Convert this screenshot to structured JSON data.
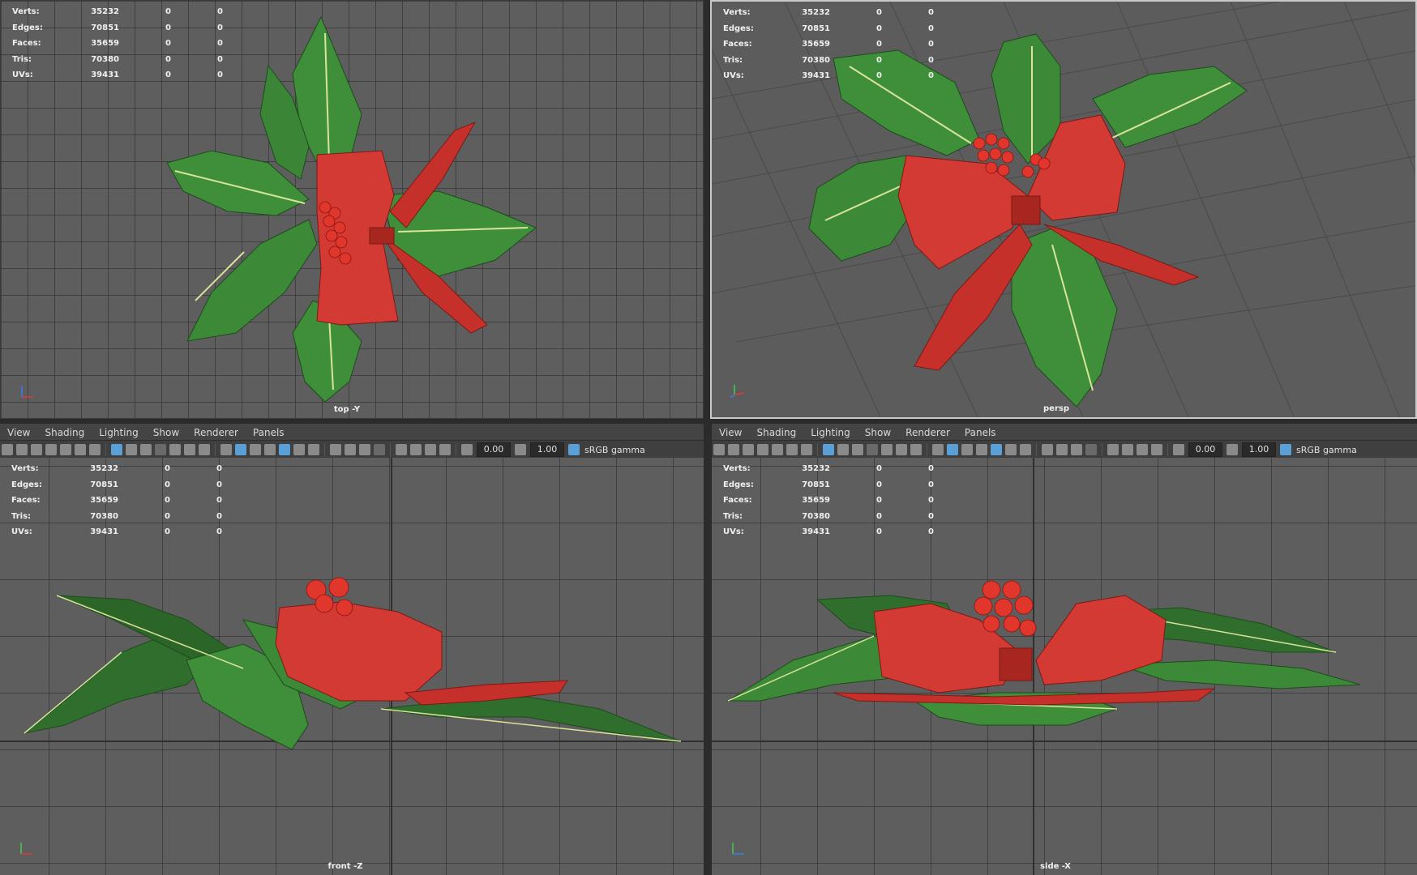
{
  "hud": {
    "rows": [
      {
        "label": "Verts:",
        "value": "35232",
        "c1": "0",
        "c2": "0"
      },
      {
        "label": "Edges:",
        "value": "70851",
        "c1": "0",
        "c2": "0"
      },
      {
        "label": "Faces:",
        "value": "35659",
        "c1": "0",
        "c2": "0"
      },
      {
        "label": "Tris:",
        "value": "70380",
        "c1": "0",
        "c2": "0"
      },
      {
        "label": "UVs:",
        "value": "39431",
        "c1": "0",
        "c2": "0"
      }
    ]
  },
  "viewports": {
    "top": {
      "camera": "top -Y"
    },
    "persp": {
      "camera": "persp"
    },
    "front": {
      "camera": "front -Z"
    },
    "side": {
      "camera": "side -X"
    }
  },
  "panel_menu": [
    "View",
    "Shading",
    "Lighting",
    "Show",
    "Renderer",
    "Panels"
  ],
  "panel_toolbar": {
    "exposure": "0.00",
    "gamma": "1.00",
    "color_space": "sRGB gamma"
  },
  "colors": {
    "leaf": "#3f8f3a",
    "leaf_dark": "#2f6e2c",
    "vein": "#d9e39b",
    "ribbon": "#d23a33",
    "ribbon_dark": "#a82620",
    "berry": "#e0362c",
    "active_icon": "#5aa0d6"
  },
  "icons": [
    "camera-icon",
    "lock-camera-icon",
    "bookmark-icon",
    "image-plane-icon",
    "grid-icon",
    "wireframe-icon",
    "smooth-shade-icon",
    "textured-icon",
    "lights-icon",
    "shadows-icon",
    "isolate-icon",
    "xray-icon",
    "exposure-icon",
    "gamma-icon",
    "color-management-icon"
  ]
}
